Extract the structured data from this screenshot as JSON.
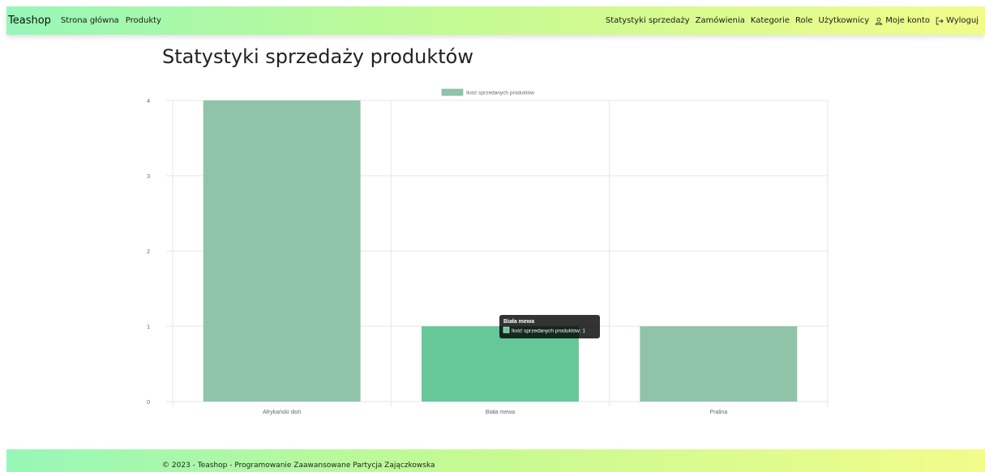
{
  "navbar": {
    "brand": "Teashop",
    "left_links": [
      {
        "label": "Strona główna"
      },
      {
        "label": "Produkty"
      }
    ],
    "right_links": [
      {
        "label": "Statystyki sprzedaży"
      },
      {
        "label": "Zamówienia"
      },
      {
        "label": "Kategorie"
      },
      {
        "label": "Role"
      },
      {
        "label": "Użytkownicy"
      },
      {
        "label": "Moje konto",
        "icon": "user-icon"
      },
      {
        "label": "Wyloguj",
        "icon": "logout-icon"
      }
    ]
  },
  "page": {
    "title": "Statystyki sprzedaży produktów"
  },
  "chart_data": {
    "type": "bar",
    "categories": [
      "Afrykański słoń",
      "Biała mewa",
      "Pralina"
    ],
    "series": [
      {
        "name": "Ilość sprzedanych produktów",
        "values": [
          4,
          1,
          1
        ],
        "color": "#8fc4a9",
        "hover_color": "#66c898"
      }
    ],
    "ylim": [
      0,
      4
    ],
    "yticks": [
      0,
      1,
      2,
      3,
      4
    ],
    "grid": true,
    "legend_position": "top-center",
    "tooltip": {
      "title": "Biała mewa",
      "label": "Ilość sprzedanych produktów: 1",
      "category_index": 1
    }
  },
  "footer": {
    "text": "© 2023 - Teashop - Programowanie Zaawansowane Partycja Zajączkowska"
  }
}
